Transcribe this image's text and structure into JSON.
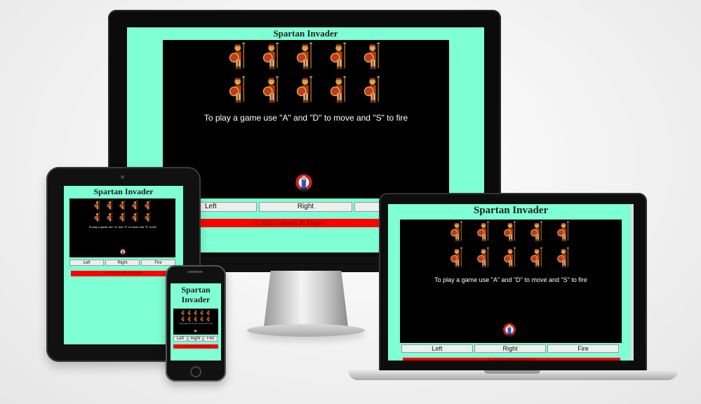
{
  "game": {
    "title": "Spartan Invader",
    "title_phone_line1": "Spartan",
    "title_phone_line2": "Invader",
    "instructions": "To play a game use \"A\" and \"D\" to move and \"S\" to fire",
    "controls": {
      "left": "Left",
      "right": "Right",
      "fire": "Fire"
    },
    "footer": "© 2021 Gabriel's JS Project",
    "invader_rows": 2,
    "invaders_per_row": 5
  },
  "colors": {
    "page_background": "#7fffd4",
    "board": "#000000",
    "footer": "#ff0000",
    "text_on_board": "#ffffff"
  },
  "icons": {
    "enemy": "spartan-warrior-icon",
    "player": "player-ship-icon"
  }
}
